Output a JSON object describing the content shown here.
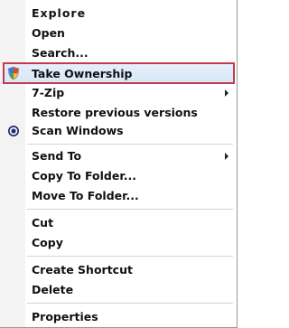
{
  "menu": {
    "items": [
      {
        "label": "Explore"
      },
      {
        "label": "Open"
      },
      {
        "label": "Search..."
      },
      {
        "label": "Take Ownership"
      },
      {
        "label": "7-Zip"
      },
      {
        "label": "Restore previous versions"
      },
      {
        "label": "Scan Windows"
      },
      {
        "label": "Send To"
      },
      {
        "label": "Copy To Folder..."
      },
      {
        "label": "Move To Folder..."
      },
      {
        "label": "Cut"
      },
      {
        "label": "Copy"
      },
      {
        "label": "Create Shortcut"
      },
      {
        "label": "Delete"
      },
      {
        "label": "Properties"
      }
    ]
  },
  "icons": {
    "take_ownership": "shield-icon",
    "scan_windows": "antivirus-icon"
  },
  "colors": {
    "highlight_border": "#c33a4a",
    "highlight_bg": "#dbe8f8",
    "text": "#111111",
    "separator": "#d4d4d4"
  }
}
